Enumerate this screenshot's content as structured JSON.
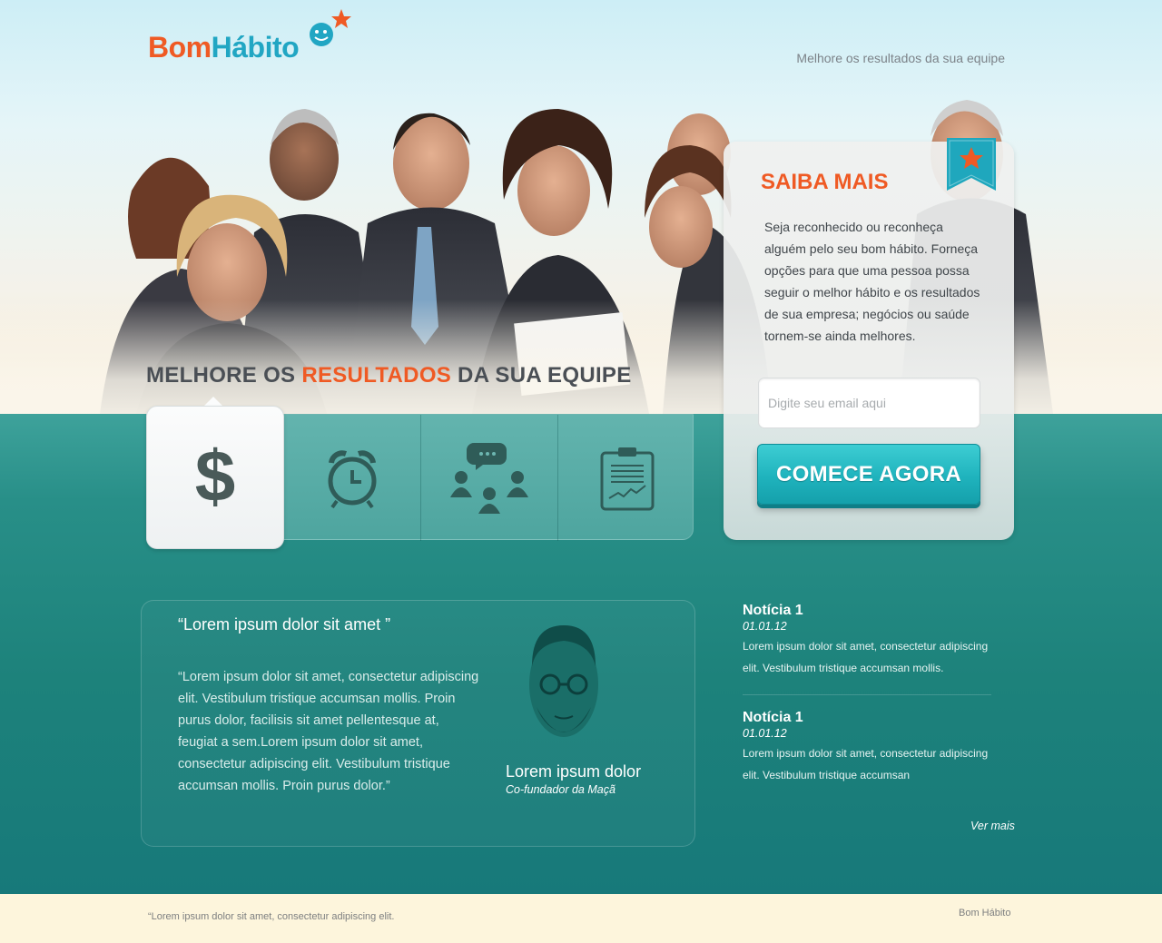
{
  "brand": {
    "part1": "Bom",
    "part2": "Hábito"
  },
  "header": {
    "tagline": "Melhore os resultados da sua equipe"
  },
  "hero": {
    "headline_pre": "MELHORE OS ",
    "headline_accent": "RESULTADOS",
    "headline_post": " DA SUA EQUIPE"
  },
  "feature_tabs": [
    {
      "icon": "dollar-icon",
      "active": true
    },
    {
      "icon": "alarm-clock-icon",
      "active": false
    },
    {
      "icon": "people-chat-icon",
      "active": false
    },
    {
      "icon": "clipboard-chart-icon",
      "active": false
    }
  ],
  "signup_panel": {
    "title": "SAIBA MAIS",
    "description": "Seja reconhecido ou reconheça alguém pelo seu bom hábito. Forneça opções para que uma pessoa possa seguir o melhor hábito e os resultados de sua empresa; negócios ou saúde tornem-se ainda melhores.",
    "email_placeholder": "Digite seu email aqui",
    "cta_label": "COMECE AGORA"
  },
  "testimonial": {
    "title": "“Lorem ipsum dolor sit amet ”",
    "body": "“Lorem ipsum dolor sit amet, consectetur adipiscing elit. Vestibulum tristique accumsan mollis. Proin purus dolor, facilisis sit amet pellentesque at, feugiat a sem.Lorem ipsum dolor sit amet, consectetur adipiscing elit. Vestibulum tristique accumsan mollis. Proin purus dolor.”",
    "author": "Lorem ipsum dolor",
    "role": "Co-fundador da Maçã"
  },
  "news": [
    {
      "title": "Notícia 1",
      "date": "01.01.12",
      "text": "Lorem ipsum dolor sit amet, consectetur adipiscing elit. Vestibulum tristique accumsan mollis."
    },
    {
      "title": "Notícia 1",
      "date": "01.01.12",
      "text": "Lorem ipsum dolor sit amet, consectetur adipiscing elit. Vestibulum tristique accumsan"
    }
  ],
  "news_more_link": "Ver mais",
  "footer": {
    "quote": "“Lorem ipsum dolor sit amet, consectetur adipiscing elit.",
    "brand": "Bom Hábito"
  },
  "colors": {
    "accent_orange": "#ef5a24",
    "brand_blue": "#21a6c3",
    "teal_bg": "#1d827b",
    "cta_teal": "#1fb3bd",
    "footer_bg": "#fdf5dc"
  }
}
